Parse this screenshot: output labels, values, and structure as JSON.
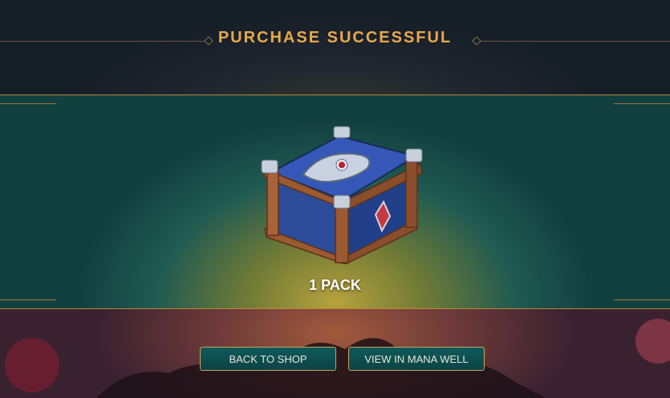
{
  "header": {
    "title": "PURCHASE SUCCESSFUL"
  },
  "reward": {
    "icon": "treasure-chest-icon",
    "label": "1 PACK"
  },
  "buttons": {
    "back_label": "BACK TO SHOP",
    "view_label": "VIEW IN MANA WELL"
  },
  "colors": {
    "title": "#e9a94b",
    "button_bg": "#0f5a5c",
    "button_border": "#c9a45a"
  }
}
